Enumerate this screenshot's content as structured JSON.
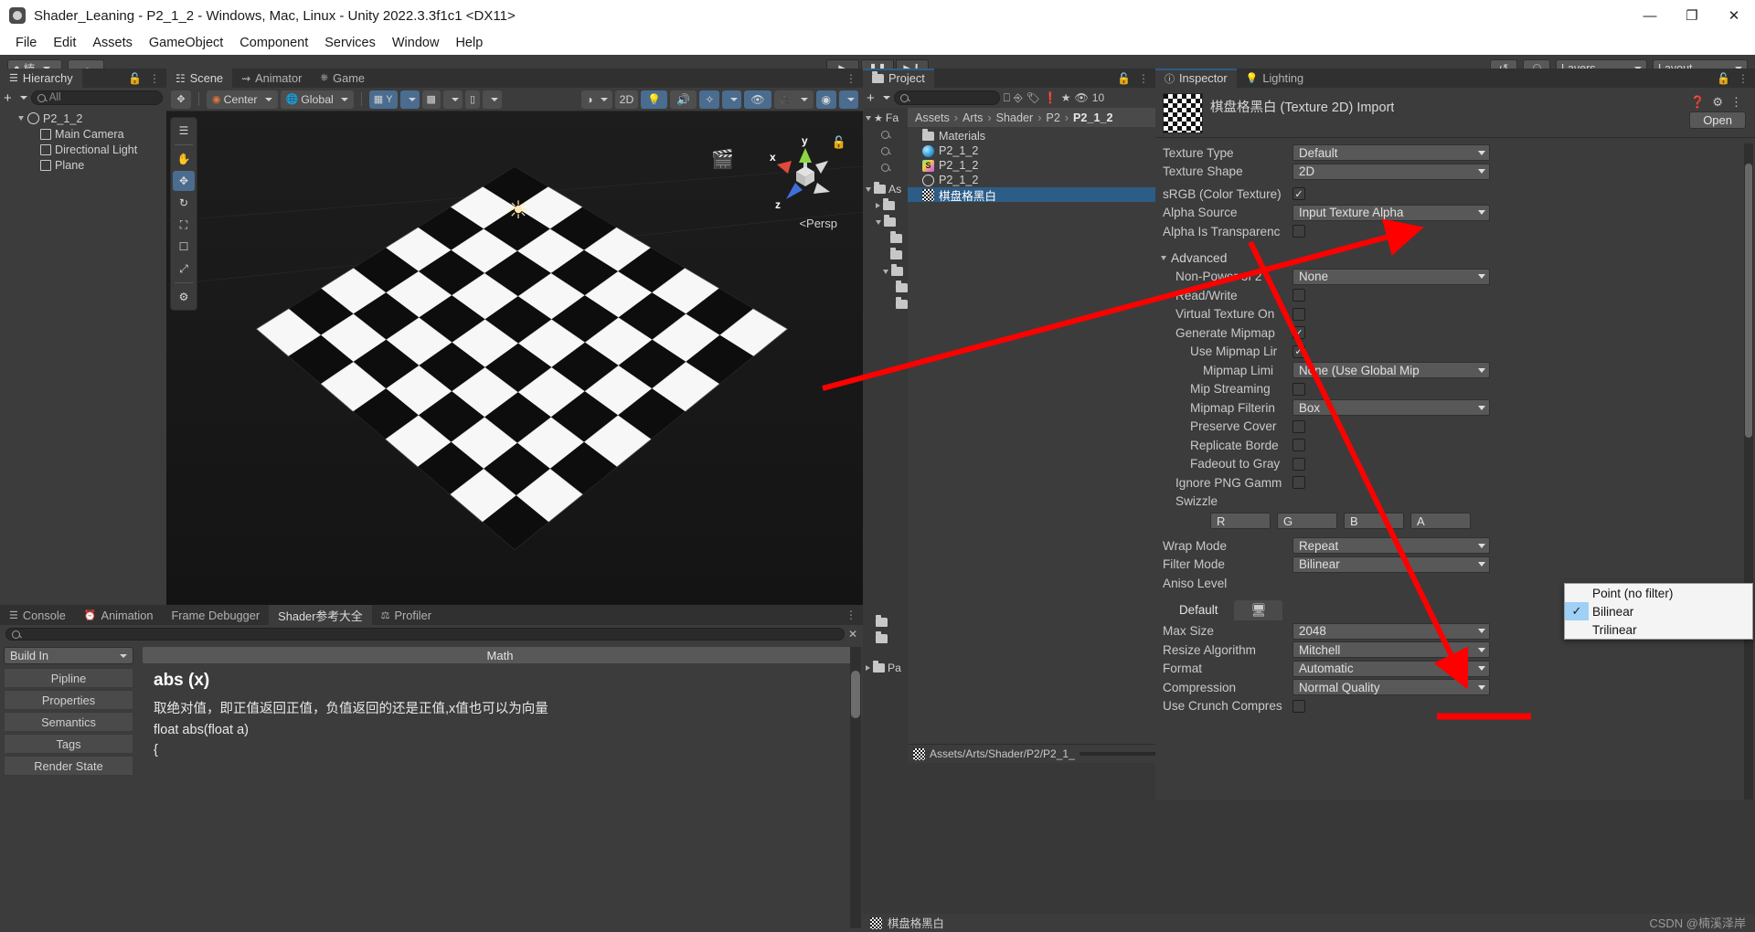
{
  "window": {
    "title": "Shader_Leaning - P2_1_2 - Windows, Mac, Linux - Unity 2022.3.3f1c1 <DX11>",
    "minimize": "—",
    "maximize": "❐",
    "close": "✕"
  },
  "menu": [
    "File",
    "Edit",
    "Assets",
    "GameObject",
    "Component",
    "Services",
    "Window",
    "Help"
  ],
  "toolbar": {
    "account": "楠",
    "cloud_icon": "cloud-icon",
    "play": "▶",
    "pause": "❚❚",
    "step": "▶❙",
    "history_icon": "history-icon",
    "search_icon": "search-icon",
    "layers": "Layers",
    "layout": "Layout"
  },
  "hierarchy": {
    "tab": "Hierarchy",
    "search_placeholder": "All",
    "items": [
      {
        "label": "P2_1_2",
        "icon": "unity-scene-icon",
        "depth": 0
      },
      {
        "label": "Main Camera",
        "icon": "gameobject-icon",
        "depth": 1
      },
      {
        "label": "Directional Light",
        "icon": "gameobject-icon",
        "depth": 1
      },
      {
        "label": "Plane",
        "icon": "gameobject-icon",
        "depth": 1
      }
    ]
  },
  "scene": {
    "tabs": [
      {
        "label": "Scene",
        "icon": "grid-icon",
        "active": true
      },
      {
        "label": "Animator",
        "icon": "animator-icon",
        "active": false
      },
      {
        "label": "Game",
        "icon": "gamepad-icon",
        "active": false
      }
    ],
    "toolbar": {
      "pivot": "Center",
      "handle": "Global",
      "grid_axis": "Y",
      "shading": "Shaded",
      "mode_2d": "2D",
      "lighting_icon": "light-bulb-icon",
      "audio_icon": "audio-icon",
      "fx_icon": "effects-icon",
      "hidden_icon": "visibility-off-icon",
      "camera_icon": "scene-camera-icon",
      "gizmos_icon": "gizmos-icon"
    },
    "tools": [
      "hand-tool",
      "move-tool",
      "rotate-tool",
      "scale-tool",
      "rect-tool",
      "transform-tool",
      "custom-tool"
    ],
    "gizmo": {
      "x": "x",
      "y": "y",
      "z": "z",
      "persp": "Persp"
    }
  },
  "project": {
    "tab": "Project",
    "search_placeholder": "",
    "badge_count": "10",
    "favorites_label": "Fa",
    "assets_label": "As",
    "breadcrumb": [
      "Assets",
      "Arts",
      "Shader",
      "P2",
      "P2_1_2"
    ],
    "items": [
      {
        "label": "Materials",
        "icon": "folder-icon",
        "selected": false
      },
      {
        "label": "P2_1_2",
        "icon": "material-icon",
        "selected": false
      },
      {
        "label": "P2_1_2",
        "icon": "shader-icon",
        "selected": false
      },
      {
        "label": "P2_1_2",
        "icon": "prefab-icon",
        "selected": false
      },
      {
        "label": "棋盘格黑白",
        "icon": "texture-checker-icon",
        "selected": true
      }
    ],
    "status_path": "Assets/Arts/Shader/P2/P2_1_"
  },
  "inspector": {
    "tabs": [
      {
        "label": "Inspector",
        "icon": "info-icon",
        "active": true
      },
      {
        "label": "Lighting",
        "icon": "light-icon",
        "active": false
      }
    ],
    "asset_title": "棋盘格黑白 (Texture 2D) Import",
    "open_button": "Open",
    "help_icon": "help-icon",
    "preset_icon": "preset-icon",
    "menu_icon": "kebab-menu-icon",
    "fields": [
      {
        "label": "Texture Type",
        "type": "dropdown",
        "value": "Default",
        "indent": 0
      },
      {
        "label": "Texture Shape",
        "type": "dropdown",
        "value": "2D",
        "indent": 0
      },
      {
        "label": "sRGB (Color Texture)",
        "type": "checkbox",
        "value": true,
        "indent": 0
      },
      {
        "label": "Alpha Source",
        "type": "dropdown",
        "value": "Input Texture Alpha",
        "indent": 0
      },
      {
        "label": "Alpha Is Transparenc",
        "type": "checkbox",
        "value": false,
        "indent": 0
      }
    ],
    "advanced_label": "Advanced",
    "advanced_fields": [
      {
        "label": "Non-Power of 2",
        "type": "dropdown",
        "value": "None",
        "indent": 1
      },
      {
        "label": "Read/Write",
        "type": "checkbox",
        "value": false,
        "indent": 1
      },
      {
        "label": "Virtual Texture On",
        "type": "checkbox",
        "value": false,
        "indent": 1
      },
      {
        "label": "Generate Mipmap",
        "type": "checkbox",
        "value": true,
        "indent": 1
      },
      {
        "label": "Use Mipmap Lir",
        "type": "checkbox",
        "value": true,
        "indent": 2
      },
      {
        "label": "Mipmap Limi",
        "type": "dropdown",
        "value": "None (Use Global Mip",
        "indent": 3
      },
      {
        "label": "Mip Streaming",
        "type": "checkbox",
        "value": false,
        "indent": 2
      },
      {
        "label": "Mipmap Filterin",
        "type": "dropdown",
        "value": "Box",
        "indent": 2
      },
      {
        "label": "Preserve Cover",
        "type": "checkbox",
        "value": false,
        "indent": 2
      },
      {
        "label": "Replicate Borde",
        "type": "checkbox",
        "value": false,
        "indent": 2
      },
      {
        "label": "Fadeout to Gray",
        "type": "checkbox",
        "value": false,
        "indent": 2
      },
      {
        "label": "Ignore PNG Gamm",
        "type": "checkbox",
        "value": false,
        "indent": 1
      }
    ],
    "swizzle_label": "Swizzle",
    "swizzle": [
      "R",
      "G",
      "B",
      "A"
    ],
    "wrap_mode": {
      "label": "Wrap Mode",
      "value": "Repeat"
    },
    "filter_mode": {
      "label": "Filter Mode",
      "value": "Bilinear"
    },
    "aniso_level": {
      "label": "Aniso Level",
      "value": ""
    },
    "platform_tabs": [
      {
        "label": "Default",
        "active": true
      },
      {
        "label": "",
        "icon": "desktop-icon",
        "active": false
      }
    ],
    "platform_fields": [
      {
        "label": "Max Size",
        "value": "2048"
      },
      {
        "label": "Resize Algorithm",
        "value": "Mitchell"
      },
      {
        "label": "Format",
        "value": "Automatic"
      },
      {
        "label": "Compression",
        "value": "Normal Quality"
      },
      {
        "label": "Use Crunch Compres",
        "value": ""
      }
    ],
    "status_asset": "棋盘格黑白"
  },
  "filter_dropdown": {
    "options": [
      {
        "label": "Point (no filter)",
        "checked": false
      },
      {
        "label": "Bilinear",
        "checked": true
      },
      {
        "label": "Trilinear",
        "checked": false
      }
    ]
  },
  "bottom": {
    "tabs": [
      {
        "label": "Console",
        "icon": "console-icon",
        "active": false
      },
      {
        "label": "Animation",
        "icon": "animation-icon",
        "active": false
      },
      {
        "label": "Frame Debugger",
        "icon": "",
        "active": false
      },
      {
        "label": "Shader参考大全",
        "icon": "",
        "active": true
      },
      {
        "label": "Profiler",
        "icon": "profiler-icon",
        "active": false
      }
    ],
    "left_select": "Build In",
    "left_items": [
      "Pipline",
      "Properties",
      "Semantics",
      "Tags",
      "Render State"
    ],
    "content_header": "Math",
    "fn_name": "abs (x)",
    "fn_desc": "取绝对值，即正值返回正值，负值返回的还是正值,x值也可以为向量",
    "fn_code": "float abs(float a)",
    "fn_brace": "{"
  },
  "watermark": "CSDN @楠溪泽岸",
  "colors": {
    "accent_blue": "#4a6c8f",
    "selection_blue": "#2c5d87",
    "panel_bg": "#3c3c3c",
    "annotation_red": "#ff0000"
  }
}
